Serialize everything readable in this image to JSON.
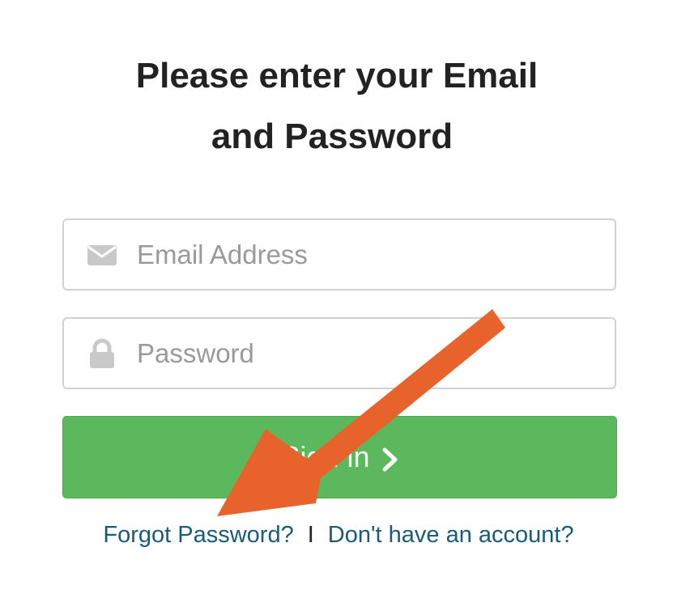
{
  "heading": {
    "line1": "Please enter your Email",
    "line2": "and Password"
  },
  "email_field": {
    "placeholder": "Email Address",
    "value": "",
    "icon": "envelope-icon"
  },
  "password_field": {
    "placeholder": "Password",
    "value": "",
    "icon": "lock-icon"
  },
  "signin_button": {
    "label": "Sign in",
    "icon": "chevron-right-icon"
  },
  "links": {
    "forgot_password": "Forgot Password?",
    "separator": "I",
    "no_account": "Don't have an account?"
  },
  "annotation": {
    "type": "arrow",
    "color": "#E8632B",
    "points_to": "forgot-password-link"
  },
  "colors": {
    "heading": "#222222",
    "button": "#5CB85C",
    "link": "#1A5A7A",
    "placeholder": "#9A9A9A",
    "icon": "#C9C9C9"
  }
}
